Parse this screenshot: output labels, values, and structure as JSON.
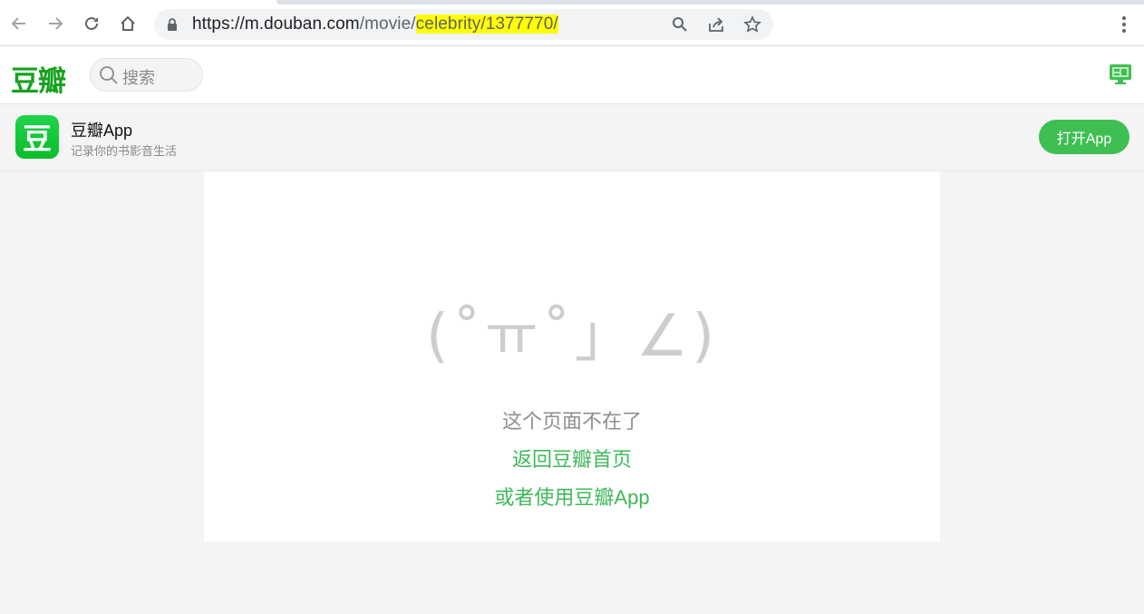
{
  "browser": {
    "url_host": "https://m.douban.com",
    "url_path": "/movie/",
    "url_highlight": "celebrity/1377770/",
    "icons": [
      "back-icon",
      "forward-icon",
      "reload-icon",
      "home-icon",
      "lock-icon",
      "search-icon",
      "share-icon",
      "star-icon",
      "menu-icon"
    ]
  },
  "header": {
    "logo": "豆瓣",
    "search_placeholder": "搜索"
  },
  "banner": {
    "icon_text": "豆",
    "app_name": "豆瓣App",
    "slogan": "记录你的书影音生活",
    "open_button": "打开App"
  },
  "error": {
    "kaomoji": "(˚ㅠ˚」∠)",
    "message": "这个页面不在了",
    "home_link": "返回豆瓣首页",
    "app_link": "或者使用豆瓣App"
  },
  "colors": {
    "brand": "#18a21f",
    "link": "#40b85a",
    "button": "#3fbf52"
  }
}
